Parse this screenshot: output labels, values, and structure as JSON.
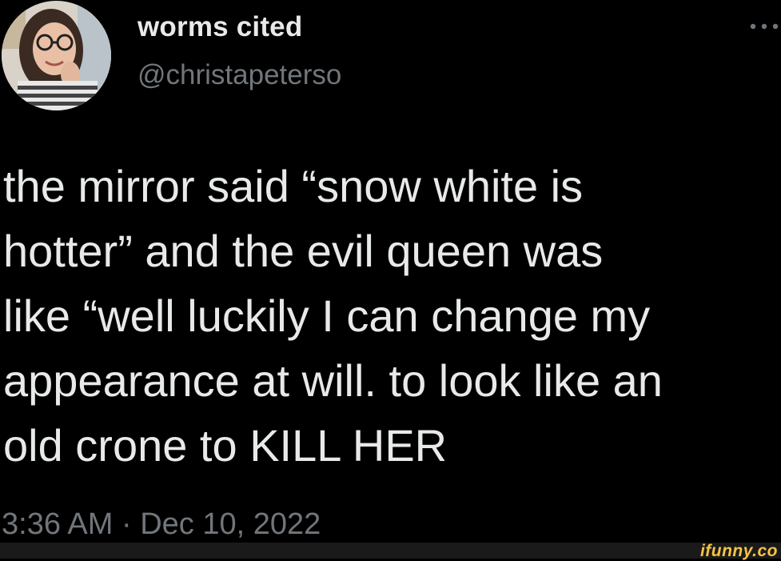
{
  "tweet": {
    "display_name": "worms cited",
    "handle": "@christapeterso",
    "text_lines": [
      "the mirror said “snow white is",
      "hotter” and the evil queen was",
      "like “well luckily I can change my",
      "appearance at will. to look like an",
      "old crone to KILL HER"
    ],
    "timestamp": "3:36 AM · Dec 10, 2022"
  },
  "icons": {
    "more": "more-horizontal-icon",
    "avatar": "profile-photo"
  },
  "watermark": {
    "text": "ifunny.co"
  },
  "colors": {
    "background": "#000000",
    "primary_text": "#e7e9ea",
    "secondary_text": "#71767b",
    "watermark": "#f6c445"
  }
}
